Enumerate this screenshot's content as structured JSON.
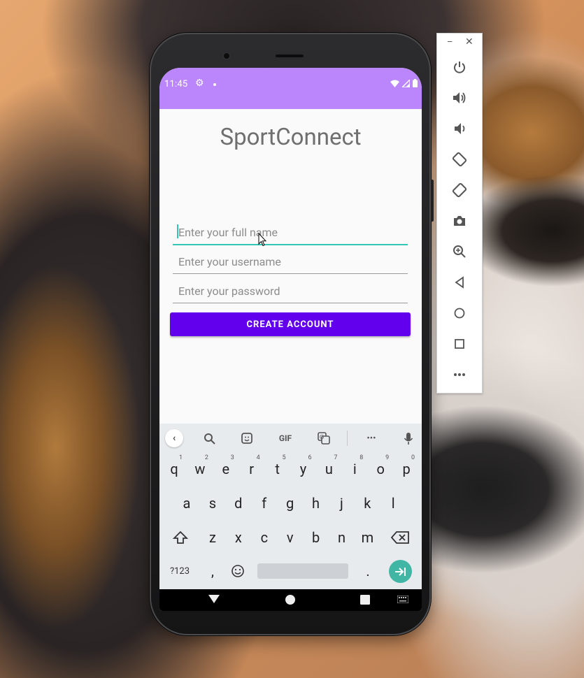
{
  "status_bar": {
    "time": "11:45"
  },
  "app": {
    "title": "SportConnect",
    "fields": {
      "full_name_placeholder": "Enter your full name",
      "username_placeholder": "Enter your username",
      "password_placeholder": "Enter your password"
    },
    "create_button_label": "CREATE ACCOUNT"
  },
  "keyboard": {
    "toolbar": {
      "gif_label": "GIF",
      "more_label": "•••"
    },
    "row1": [
      {
        "key": "q",
        "hint": "1"
      },
      {
        "key": "w",
        "hint": "2"
      },
      {
        "key": "e",
        "hint": "3"
      },
      {
        "key": "r",
        "hint": "4"
      },
      {
        "key": "t",
        "hint": "5"
      },
      {
        "key": "y",
        "hint": "6"
      },
      {
        "key": "u",
        "hint": "7"
      },
      {
        "key": "i",
        "hint": "8"
      },
      {
        "key": "o",
        "hint": "9"
      },
      {
        "key": "p",
        "hint": "0"
      }
    ],
    "row2": [
      "a",
      "s",
      "d",
      "f",
      "g",
      "h",
      "j",
      "k",
      "l"
    ],
    "row3": [
      "z",
      "x",
      "c",
      "v",
      "b",
      "n",
      "m"
    ],
    "bottom": {
      "symbols_label": "?123",
      "comma": ",",
      "period": "."
    }
  },
  "emulator_toolbar": {
    "buttons": [
      "power-icon",
      "volume-up-icon",
      "volume-down-icon",
      "rotate-left-icon",
      "rotate-right-icon",
      "camera-icon",
      "zoom-icon",
      "back-icon",
      "home-icon",
      "overview-icon",
      "more-icon"
    ]
  },
  "colors": {
    "status_bar": "#bb86fc",
    "primary_button": "#6200ee",
    "focus_accent": "#31c7b4",
    "keyboard_enter": "#41b6a5"
  }
}
